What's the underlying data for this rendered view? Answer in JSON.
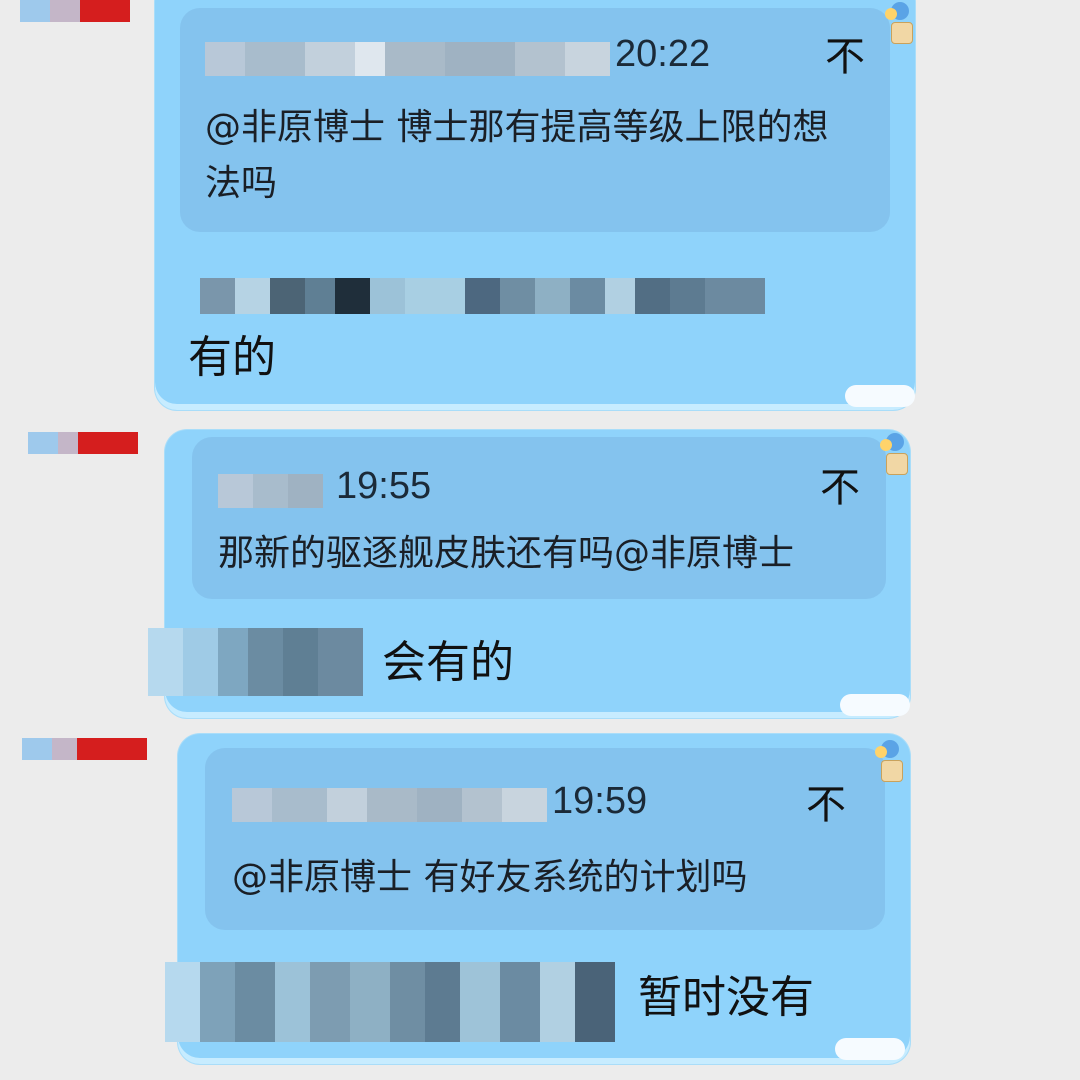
{
  "messages": [
    {
      "quote_time": "20:22",
      "quote_text": "@非原博士 博士那有提高等级上限的想法吗",
      "quote_icon": "不",
      "reply": "有的"
    },
    {
      "quote_time": "19:55",
      "quote_text": "那新的驱逐舰皮肤还有吗@非原博士",
      "quote_icon": "不",
      "reply": "会有的"
    },
    {
      "quote_time": "19:59",
      "quote_text": "@非原博士 有好友系统的计划吗",
      "quote_icon": "不",
      "reply": "暂时没有"
    }
  ],
  "colors": {
    "bubble": "#8fd3fb",
    "quote_box": "#84c3ee",
    "background": "#ececec"
  }
}
